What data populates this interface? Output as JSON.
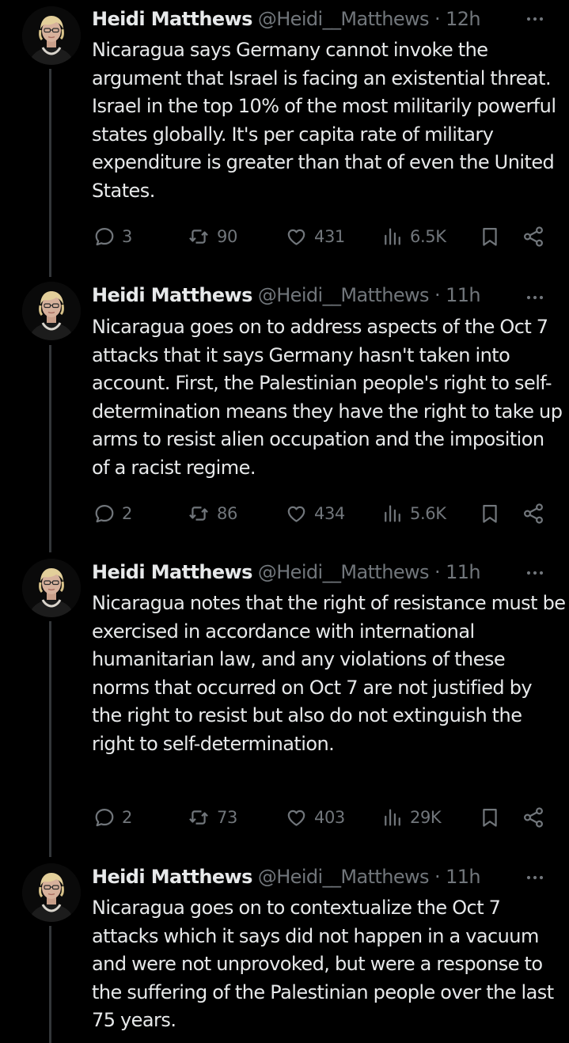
{
  "tweets": [
    {
      "name": "Heidi Matthews",
      "handle": "@Heidi__Matthews",
      "separator": "·",
      "time": "12h",
      "text": "Nicaragua says Germany cannot invoke the argument that Israel is facing an existential threat. Israel in the top 10% of the most militarily powerful states globally. It's per capita rate of military expenditure is greater than that of even the United States.",
      "replies": "3",
      "reposts": "90",
      "likes": "431",
      "views": "6.5K"
    },
    {
      "name": "Heidi Matthews",
      "handle": "@Heidi__Matthews",
      "separator": "·",
      "time": "11h",
      "text": "Nicaragua goes on to address aspects of the Oct 7 attacks that it says Germany hasn't taken into account. First, the Palestinian people's right to self-determination means they have the right to take up arms to resist alien occupation and the imposition of a racist regime.",
      "replies": "2",
      "reposts": "86",
      "likes": "434",
      "views": "5.6K"
    },
    {
      "name": "Heidi Matthews",
      "handle": "@Heidi__Matthews",
      "separator": "·",
      "time": "11h",
      "text": "Nicaragua notes that the right of resistance must be exercised in accordance with international humanitarian law, and any violations of these norms that occurred on Oct 7 are not justified by the right to resist but also do not extinguish the right to self-determination.",
      "replies": "2",
      "reposts": "73",
      "likes": "403",
      "views": "29K"
    },
    {
      "name": "Heidi Matthews",
      "handle": "@Heidi__Matthews",
      "separator": "·",
      "time": "11h",
      "text": "Nicaragua goes on to contextualize the Oct 7 attacks which it says did not happen in a vacuum and were not unprovoked, but were a response to the suffering of the Palestinian people over the last 75 years."
    }
  ],
  "icons": {
    "reply": "speech-bubble-icon",
    "repost": "repost-arrows-icon",
    "like": "heart-icon",
    "views": "bar-chart-icon",
    "bookmark": "bookmark-icon",
    "share": "share-nodes-icon",
    "more": "more-dots-icon"
  },
  "colors": {
    "background": "#000000",
    "text_primary": "#e7e9ea",
    "text_secondary": "#71767b",
    "thread_line": "#333639"
  }
}
